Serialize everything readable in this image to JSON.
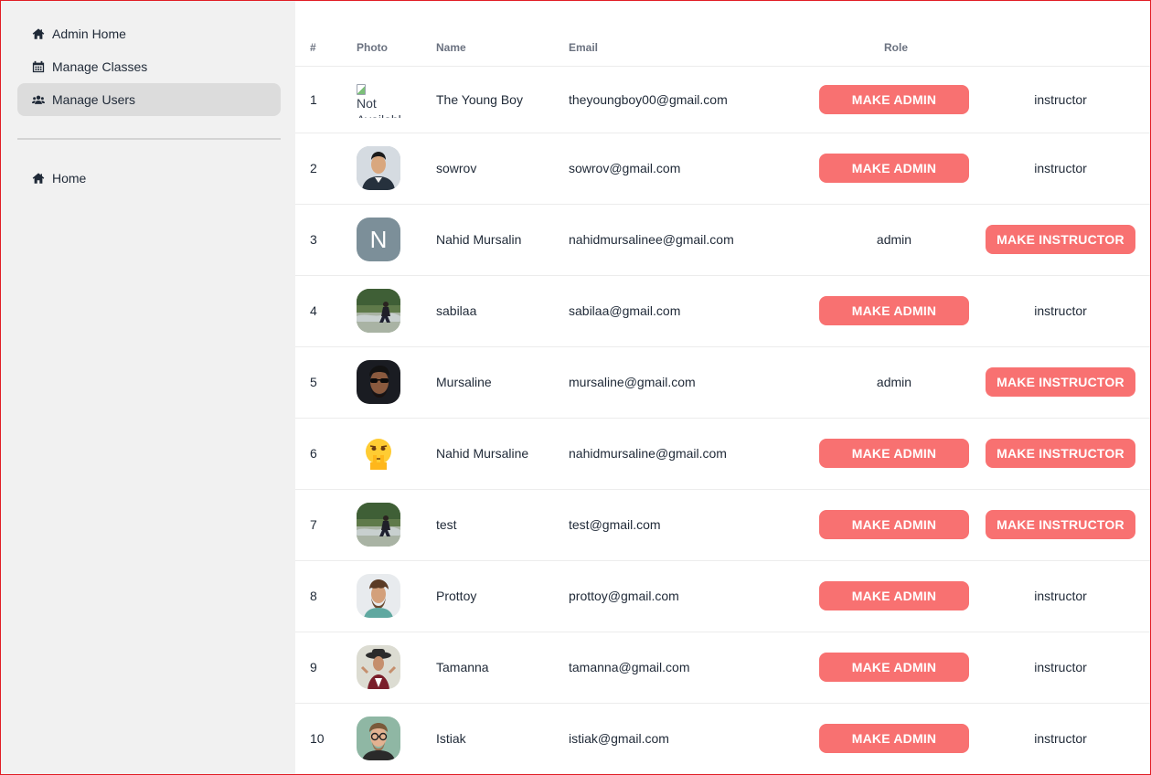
{
  "sidebar": {
    "items": [
      {
        "label": "Admin Home",
        "icon": "home-icon",
        "active": false
      },
      {
        "label": "Manage Classes",
        "icon": "calendar-icon",
        "active": false
      },
      {
        "label": "Manage Users",
        "icon": "users-icon",
        "active": true
      }
    ],
    "bottom_items": [
      {
        "label": "Home",
        "icon": "home-icon"
      }
    ]
  },
  "table": {
    "headers": {
      "num": "#",
      "photo": "Photo",
      "name": "Name",
      "email": "Email",
      "role": "Role"
    },
    "make_admin_label": "MAKE ADMIN",
    "make_instructor_label": "MAKE INSTRUCTOR",
    "rows": [
      {
        "num": "1",
        "photo_alt": "Not Availabl",
        "photo": "broken-image",
        "name": "The Young Boy",
        "email": "theyoungboy00@gmail.com",
        "col1": "MAKE ADMIN",
        "col2": "instructor"
      },
      {
        "num": "2",
        "photo": "man-portrait",
        "name": "sowrov",
        "email": "sowrov@gmail.com",
        "col1": "MAKE ADMIN",
        "col2": "instructor"
      },
      {
        "num": "3",
        "photo": "letter-avatar",
        "photo_letter": "N",
        "name": "Nahid Mursalin",
        "email": "nahidmursalinee@gmail.com",
        "col1": "admin",
        "col2": "MAKE INSTRUCTOR"
      },
      {
        "num": "4",
        "photo": "outdoor-river",
        "name": "sabilaa",
        "email": "sabilaa@gmail.com",
        "col1": "MAKE ADMIN",
        "col2": "instructor"
      },
      {
        "num": "5",
        "photo": "sunglasses-man",
        "name": "Mursaline",
        "email": "mursaline@gmail.com",
        "col1": "admin",
        "col2": "MAKE INSTRUCTOR"
      },
      {
        "num": "6",
        "photo": "emoji-face",
        "name": "Nahid Mursaline",
        "email": "nahidmursaline@gmail.com",
        "col1": "MAKE ADMIN",
        "col2": "MAKE INSTRUCTOR"
      },
      {
        "num": "7",
        "photo": "outdoor-river",
        "name": "test",
        "email": "test@gmail.com",
        "col1": "MAKE ADMIN",
        "col2": "MAKE INSTRUCTOR"
      },
      {
        "num": "8",
        "photo": "curly-man",
        "name": "Prottoy",
        "email": "prottoy@gmail.com",
        "col1": "MAKE ADMIN",
        "col2": "instructor"
      },
      {
        "num": "9",
        "photo": "hat-woman",
        "name": "Tamanna",
        "email": "tamanna@gmail.com",
        "col1": "MAKE ADMIN",
        "col2": "instructor"
      },
      {
        "num": "10",
        "photo": "glasses-man",
        "name": "Istiak",
        "email": "istiak@gmail.com",
        "col1": "MAKE ADMIN",
        "col2": "instructor"
      }
    ]
  },
  "colors": {
    "accent": "#f87171",
    "sidebar_bg": "#f1f1f1",
    "active_bg": "#dcdcdc",
    "border": "#e11d25"
  }
}
